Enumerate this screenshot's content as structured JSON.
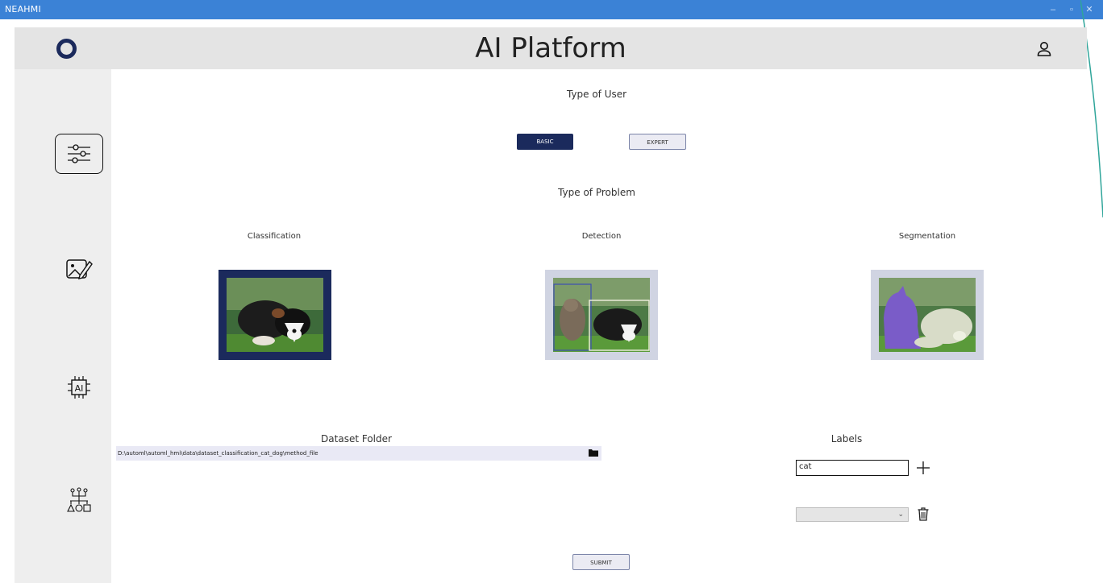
{
  "window": {
    "title": "NEAHMI",
    "minimize": "–",
    "maximize": "▫",
    "close": "✕"
  },
  "header": {
    "title": "AI Platform",
    "logo": "ring-logo",
    "user_icon": "user-icon"
  },
  "sidebar": {
    "items": [
      {
        "icon": "sliders-icon",
        "active": true
      },
      {
        "icon": "image-edit-icon",
        "active": false
      },
      {
        "icon": "ai-chip-icon",
        "active": false
      },
      {
        "icon": "network-icon",
        "active": false
      }
    ]
  },
  "user_type": {
    "heading": "Type of User",
    "basic_label": "BASIC",
    "expert_label": "EXPERT",
    "selected": "BASIC"
  },
  "problem_type": {
    "heading": "Type of Problem",
    "selected": "Classification",
    "options": [
      {
        "label": "Classification"
      },
      {
        "label": "Detection"
      },
      {
        "label": "Segmentation"
      }
    ]
  },
  "dataset": {
    "heading": "Dataset Folder",
    "path": "D:\\automl\\automl_hmi\\data\\dataset_classification_cat_dog\\method_file",
    "browse_icon": "folder-icon"
  },
  "labels": {
    "heading": "Labels",
    "input_value": "cat",
    "add_icon": "plus-icon",
    "selected_label": "",
    "delete_icon": "trash-icon"
  },
  "submit_label": "SUBMIT",
  "colors": {
    "titlebar": "#3b82d6",
    "primary": "#1b2a5c",
    "header_bg": "#e4e4e4",
    "sidebar_bg": "#eeeeee"
  }
}
